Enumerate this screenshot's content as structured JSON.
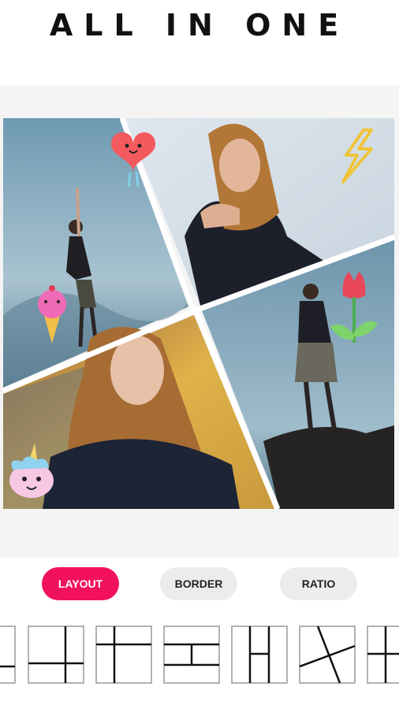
{
  "header": {
    "title": "ALL IN ONE"
  },
  "tabs": [
    {
      "label": "LAYOUT",
      "active": true
    },
    {
      "label": "BORDER",
      "active": false
    },
    {
      "label": "RATIO",
      "active": false
    }
  ],
  "colors": {
    "accent": "#f2115f",
    "tab_inactive": "#ececec",
    "canvas_bg": "#f4f4f4"
  },
  "collage": {
    "photos": [
      "photo-woman-arm-raised",
      "photo-woman-hand-chin",
      "photo-woman-portrait",
      "photo-woman-standing-rock"
    ],
    "stickers": [
      "heart-sticker",
      "lightning-sticker",
      "ice-cream-sticker",
      "tulip-sticker",
      "unicorn-sticker"
    ]
  },
  "layout_options": [
    "partial-grid",
    "four-split",
    "cross-grid",
    "rows-split",
    "columns-split",
    "diagonal-split",
    "partial-grid-right"
  ]
}
